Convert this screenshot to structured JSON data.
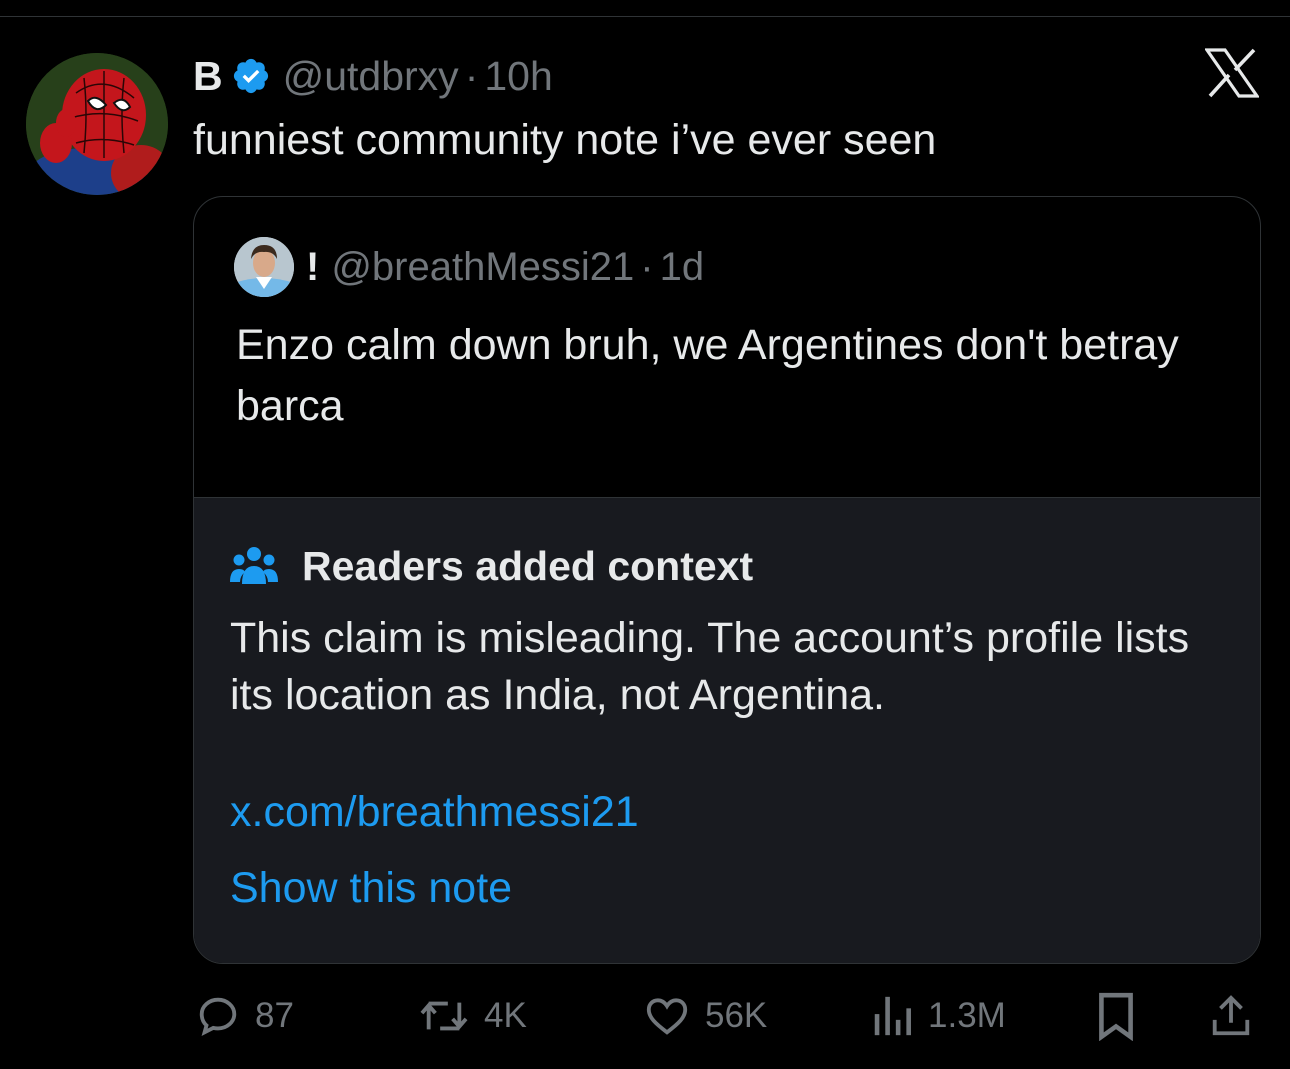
{
  "post": {
    "display_name": "B",
    "handle": "@utdbrxy",
    "separator": "·",
    "time": "10h",
    "text": "funniest community note i’ve ever seen",
    "avatar_icon": "spiderman-avatar",
    "verified_icon": "verified-badge-icon",
    "platform_logo": "x-logo-icon"
  },
  "quote": {
    "display_name": "!",
    "handle": "@breathMessi21",
    "separator": "·",
    "time": "1d",
    "text": "Enzo calm down bruh, we Argentines don't betray barca",
    "avatar_icon": "player-avatar"
  },
  "note": {
    "title": "Readers added context",
    "body": "This claim is misleading. The account’s profile lists its location as India, not Argentina.",
    "link": "x.com/breathmessi21",
    "show_label": "Show this note",
    "icon": "people-icon"
  },
  "actions": {
    "replies": "87",
    "reposts": "4K",
    "likes": "56K",
    "views": "1.3M",
    "bookmark_icon": "bookmark-icon",
    "share_icon": "share-icon"
  },
  "colors": {
    "background": "#000000",
    "note_background": "#181a1f",
    "accent": "#1d9bf0",
    "muted": "#71767b",
    "text": "#e7e9ea",
    "border": "#2f3336"
  }
}
